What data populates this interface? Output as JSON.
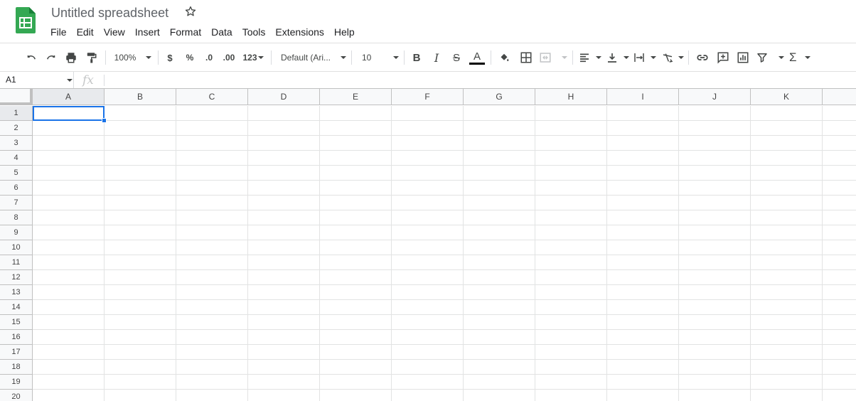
{
  "document": {
    "title": "Untitled spreadsheet"
  },
  "menu": [
    "File",
    "Edit",
    "View",
    "Insert",
    "Format",
    "Data",
    "Tools",
    "Extensions",
    "Help"
  ],
  "toolbar": {
    "zoom": "100%",
    "currency": "$",
    "percent": "%",
    "decrease_decimal": ".0",
    "increase_decimal": ".00",
    "more_formats": "123",
    "font": "Default (Ari...",
    "font_size": "10",
    "bold": "B",
    "italic": "I",
    "strike": "S",
    "text_color_letter": "A",
    "text_color": "#000000"
  },
  "formula_bar": {
    "name_box": "A1",
    "fx_label": "fx",
    "value": ""
  },
  "grid": {
    "columns": [
      "A",
      "B",
      "C",
      "D",
      "E",
      "F",
      "G",
      "H",
      "I",
      "J",
      "K"
    ],
    "rows": [
      "1",
      "2",
      "3",
      "4",
      "5",
      "6",
      "7",
      "8",
      "9",
      "10",
      "11",
      "12",
      "13",
      "14",
      "15",
      "16",
      "17",
      "18",
      "19",
      "20"
    ],
    "selected_cell": "A1"
  },
  "colors": {
    "accent": "#1a73e8",
    "logo": "#34a853"
  }
}
